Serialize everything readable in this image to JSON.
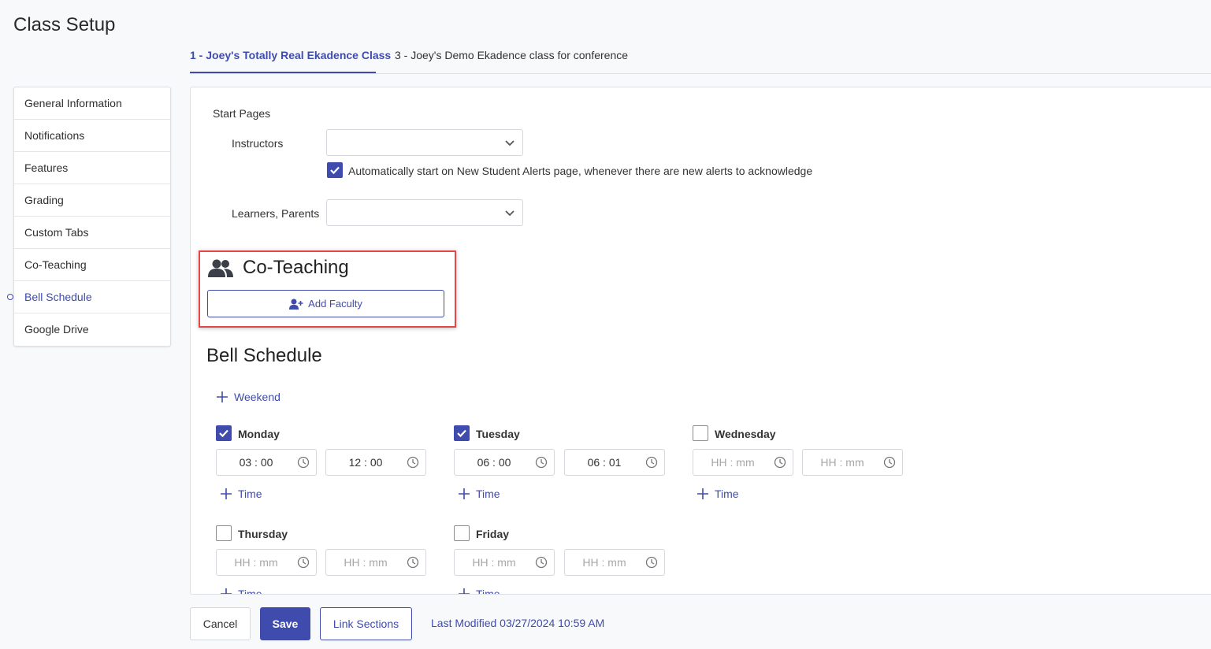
{
  "page": {
    "title": "Class Setup"
  },
  "tabs": [
    {
      "label": "1 - Joey's Totally Real Ekadence Class",
      "active": true
    },
    {
      "label": "3 - Joey's Demo Ekadence class for conference",
      "active": false
    }
  ],
  "sidebar": {
    "items": [
      {
        "label": "General Information"
      },
      {
        "label": "Notifications"
      },
      {
        "label": "Features"
      },
      {
        "label": "Grading"
      },
      {
        "label": "Custom Tabs"
      },
      {
        "label": "Co-Teaching"
      },
      {
        "label": "Bell Schedule",
        "active": true
      },
      {
        "label": "Google Drive"
      }
    ]
  },
  "start_pages": {
    "heading": "Start Pages",
    "instructors_label": "Instructors",
    "instructors_value": "",
    "auto_start_label": "Automatically start on New Student Alerts page, whenever there are new alerts to acknowledge",
    "auto_start_checked": true,
    "learners_label": "Learners, Parents",
    "learners_value": ""
  },
  "co_teaching": {
    "title": "Co-Teaching",
    "add_faculty_label": "Add Faculty"
  },
  "bell_schedule": {
    "title": "Bell Schedule",
    "weekend_label": "Weekend",
    "add_time_label": "Time",
    "placeholder": "HH : mm",
    "days": [
      {
        "name": "Monday",
        "checked": true,
        "start": "03 : 00",
        "end": "12 : 00"
      },
      {
        "name": "Tuesday",
        "checked": true,
        "start": "06 : 00",
        "end": "06 : 01"
      },
      {
        "name": "Wednesday",
        "checked": false,
        "start": "",
        "end": ""
      },
      {
        "name": "Thursday",
        "checked": false,
        "start": "",
        "end": ""
      },
      {
        "name": "Friday",
        "checked": false,
        "start": "",
        "end": ""
      }
    ]
  },
  "footer": {
    "cancel_label": "Cancel",
    "save_label": "Save",
    "link_sections_label": "Link Sections",
    "last_modified": "Last Modified 03/27/2024 10:59 AM"
  },
  "colors": {
    "accent": "#3f4bad",
    "highlight": "#e34848"
  }
}
